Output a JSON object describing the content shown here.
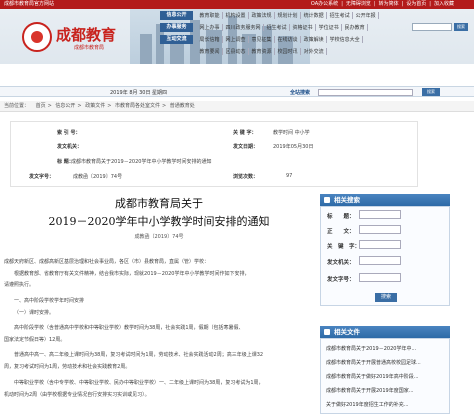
{
  "topbar": {
    "site_label": "成都市教育局官方网站",
    "links": [
      "OA办公系统",
      "无障碍浏览",
      "转为简体",
      "设为首页",
      "加入收藏"
    ]
  },
  "header": {
    "logo_title": "成都教育",
    "logo_subtitle": "成都市教育局",
    "search_button": "搜索"
  },
  "nav": [
    {
      "badge": "信息公开",
      "links": [
        "教育职能",
        "机构设置",
        "政策法规",
        "规划计划",
        "统计数据",
        "招生考试",
        "公开年报"
      ]
    },
    {
      "badge": "办事服务",
      "links": [
        "网上办事",
        "四川政务服务网",
        "招生考试",
        "资格证书",
        "学位证书",
        "民办教育"
      ]
    },
    {
      "badge": "互动交流",
      "links": [
        "局长信箱",
        "网上调查",
        "意见征集",
        "在线访谈",
        "政策解读",
        "学校信息大全"
      ]
    },
    {
      "badge": "",
      "links": [
        "教育要闻",
        "区县动态",
        "教育资源",
        "校园时讯",
        "对外交流"
      ]
    }
  ],
  "datebar": {
    "date": "2019年 8月 30日 星期四",
    "search_label": "全站搜索",
    "search_button": "搜索"
  },
  "breadcrumb": {
    "label": "当前位置：",
    "items": [
      "首页",
      "信息公开",
      "政策文件",
      "市教育局各处室文件",
      "普通教育处"
    ]
  },
  "meta": {
    "index_label": "索 引 号：",
    "index_value": "",
    "keywords_label": "关 键 字：",
    "keywords_value": "教学时间 中小学",
    "issuer_label": "发文机关：",
    "issuer_value": "",
    "date_label": "发文日期：",
    "date_value": "2019年05月30日",
    "title_label": "标 题：",
    "title_value": "成都市教育局关于2019－2020学年中小学教学时间安排的通知",
    "docno_label": "发文字号：",
    "docno_value": "成教函〔2019〕74号",
    "views_label": "浏览次数：",
    "views_value": "97"
  },
  "article": {
    "title_line1": "成都市教育局关于",
    "title_line2": "2019－2020学年中小学教学时间安排的通知",
    "doc_no": "成教函〔2019〕74号",
    "paragraphs": [
      "成都天府新区、成都高新区基层治理和社会事业局，各区（市）县教育局，直属（管）学校：",
      "根据教育部、省教育厅有关文件精神，结合我市实际，现就2019－2020学年中小学教学时间作如下安排，",
      "请遵照执行。",
      "一、高中阶段学校学年时间安排",
      "（一）课时安排。",
      "高中阶段学校（含普通高中学校和中等职业学校）教学时间为38周，社会实践1周，假期（包括寒暑假、",
      "国家法定节假日等）12周。",
      "普通高中高一、高二年级上课时间为38周，复习考试时间为1周，劳动技术、社会实践活动2周；高三年级上课32",
      "周，复习考试时间为1周，劳动技术和社会实践教育2周。",
      "中等职业学校（含中专学校、中等职业学校、民办中等职业学校）一、二年级上课时间为38周，复习考试为1周，",
      "机动时间为2周（由学校根据专业情况自行安排实习实训或见习）。"
    ]
  },
  "sidebar": {
    "search_title": "相关搜索",
    "fields": [
      "标　　题：",
      "正　　文：",
      "关　键　字：",
      "发文机关：",
      "发文字号："
    ],
    "search_button": "搜索",
    "related_title": "相关文件",
    "related": [
      "成都市教育局关于2019－2020学年中...",
      "成都市教育局关于开展普通高校校园足球...",
      "成都市教育局关于做好2019年高中阶段...",
      "成都市教育局关于开展2019年度国家...",
      "关于做好2019年度招生工作的补充..."
    ]
  }
}
